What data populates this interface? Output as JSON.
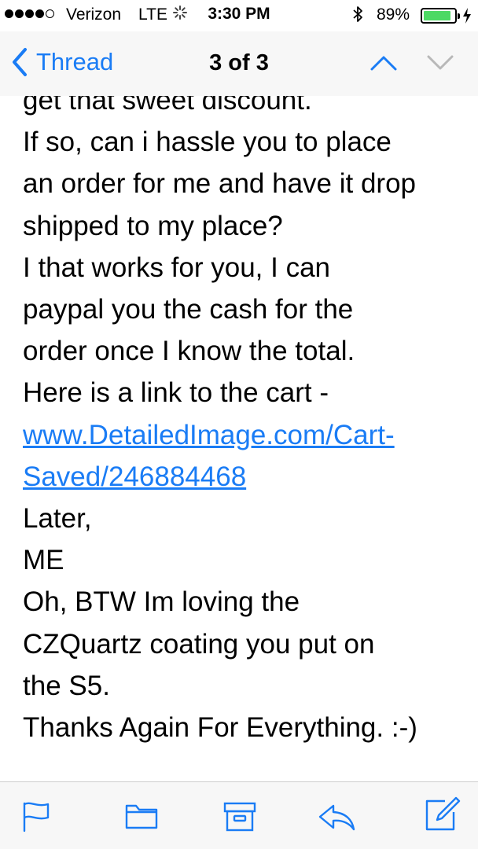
{
  "status_bar": {
    "carrier": "Verizon",
    "network": "LTE",
    "time": "3:30 PM",
    "battery_percent": "89%",
    "signal_bars": 4,
    "signal_total": 5,
    "battery_level": 0.89,
    "icons": [
      "signal-dots",
      "activity-spinner-icon",
      "bluetooth-icon",
      "battery-icon",
      "charging-bolt-icon"
    ]
  },
  "nav": {
    "back_label": "Thread",
    "title": "3 of 3",
    "icons": [
      "chevron-left-icon",
      "chevron-up-icon",
      "chevron-down-icon"
    ]
  },
  "message": {
    "lines": [
      {
        "text": "get that sweet discount."
      },
      {
        "text": "If so, can i hassle you to place"
      },
      {
        "text": "an order for me and have it drop"
      },
      {
        "text": "shipped to my place?"
      },
      {
        "text": "I that works for you, I can"
      },
      {
        "text": "paypal you the cash for the"
      },
      {
        "text": "order once I know the total."
      },
      {
        "text": "Here is a link to the cart -"
      },
      {
        "text": "www.DetailedImage.com/Cart-",
        "link": true
      },
      {
        "text": "Saved/246884468",
        "link": true
      },
      {
        "text": "Later,"
      },
      {
        "text": "ME"
      },
      {
        "text": "Oh, BTW Im loving the"
      },
      {
        "text": "CZQuartz coating you put on"
      },
      {
        "text": "the S5."
      },
      {
        "text": "Thanks Again For Everything. :-)"
      }
    ]
  },
  "toolbar": {
    "icons": [
      "flag-icon",
      "folder-icon",
      "archive-icon",
      "reply-icon",
      "compose-icon"
    ]
  },
  "colors": {
    "accent": "#1a7cf5",
    "bar_background": "#f7f7f7",
    "battery_fill": "#4cd964",
    "text": "#000000"
  }
}
